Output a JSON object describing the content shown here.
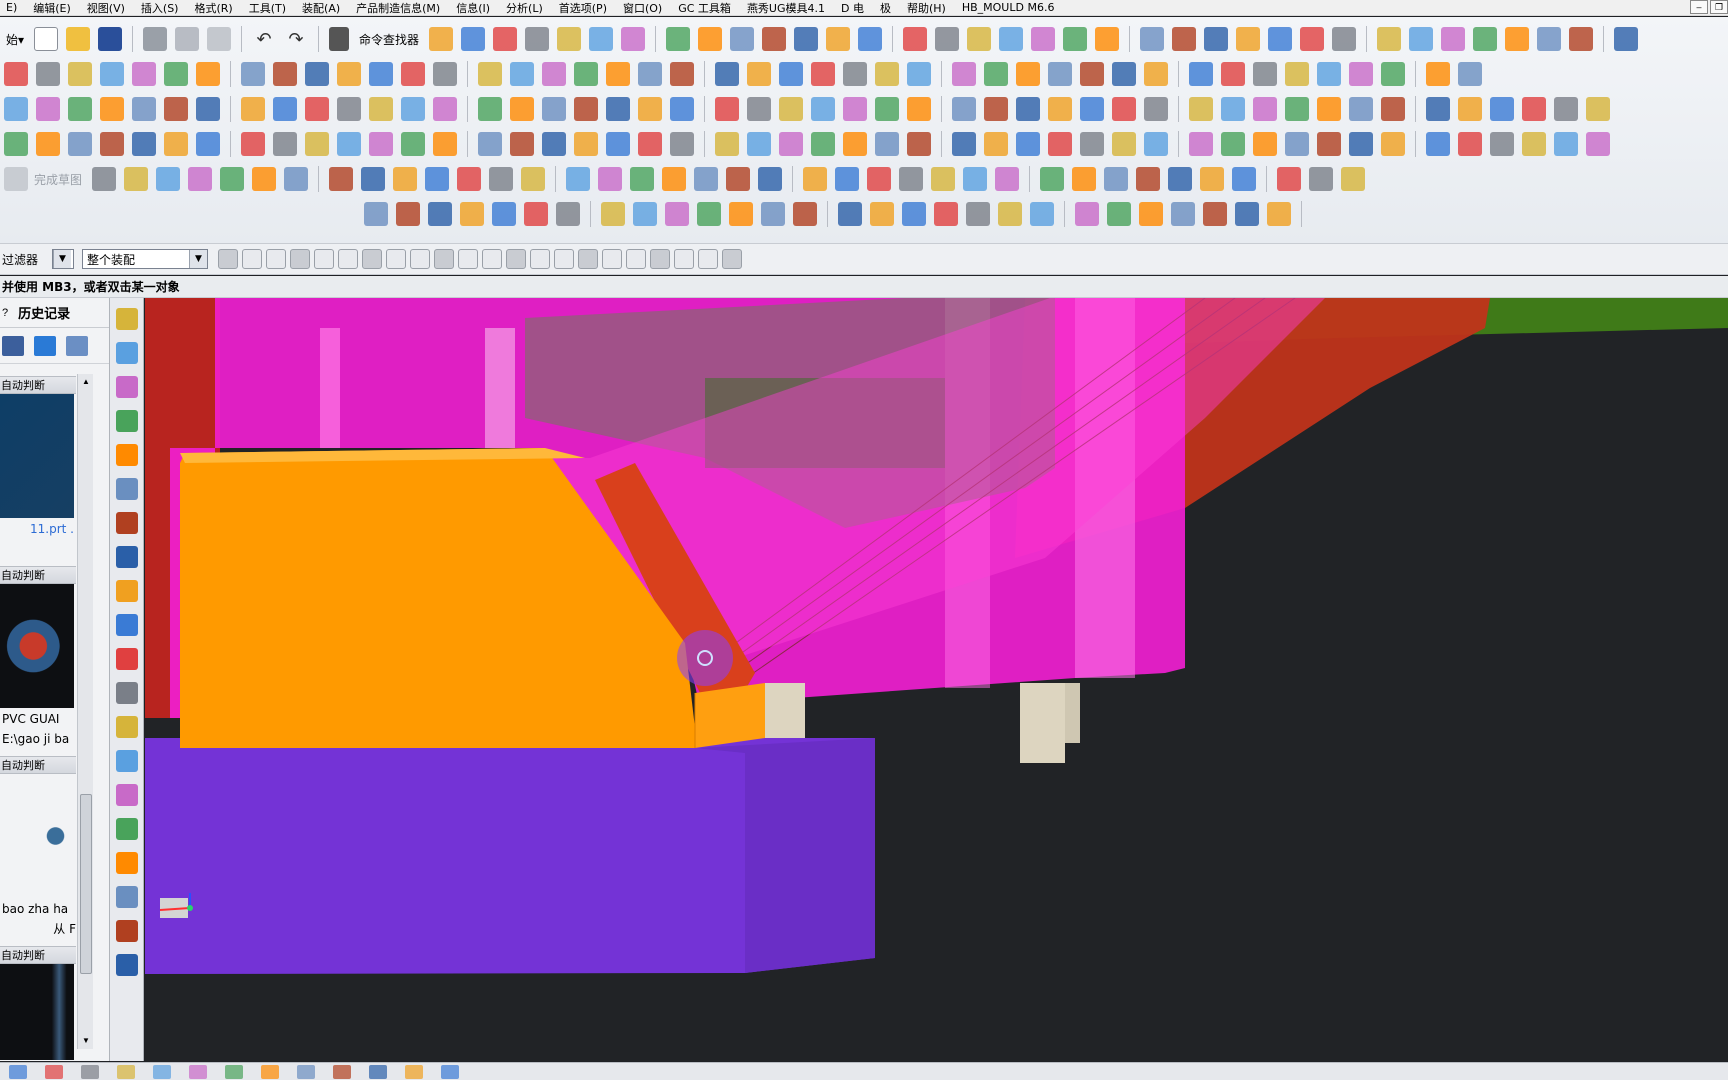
{
  "menu": {
    "items": [
      "E)",
      "编辑(E)",
      "视图(V)",
      "插入(S)",
      "格式(R)",
      "工具(T)",
      "装配(A)",
      "产品制造信息(M)",
      "信息(I)",
      "分析(L)",
      "首选项(P)",
      "窗口(O)",
      "GC 工具箱",
      "燕秀UG模具4.1",
      "D 电",
      "极",
      "帮助(H)",
      "HB_MOULD M6.6"
    ]
  },
  "toolbar": {
    "command_finder_label": "命令查找器",
    "sketch_finish_label": "完成草图"
  },
  "filterbar": {
    "filter_label": "过滤器",
    "assembly_select": "整个装配"
  },
  "status": {
    "message": "并使用 MB3，或者双击某一对象"
  },
  "history_panel": {
    "title": "历史记录",
    "groups": [
      {
        "header": "自动判断",
        "caption_1": "11.prt .",
        "caption_2": ""
      },
      {
        "header": "自动判断",
        "caption_1": "PVC GUAI",
        "caption_2": "E:\\gao ji ba"
      },
      {
        "header": "自动判断",
        "caption_1": "bao zha ha",
        "caption_2": "从 F"
      },
      {
        "header": "自动判断",
        "caption_1": "",
        "caption_2": ""
      }
    ]
  },
  "colors": {
    "orange_block": "#ff9a00",
    "magenta_part": "#ff1fd2",
    "purple_plate": "#7433d6",
    "red_slider": "#d23c1b",
    "green_part": "#3f7a18",
    "viewport_bg": "#212326"
  }
}
